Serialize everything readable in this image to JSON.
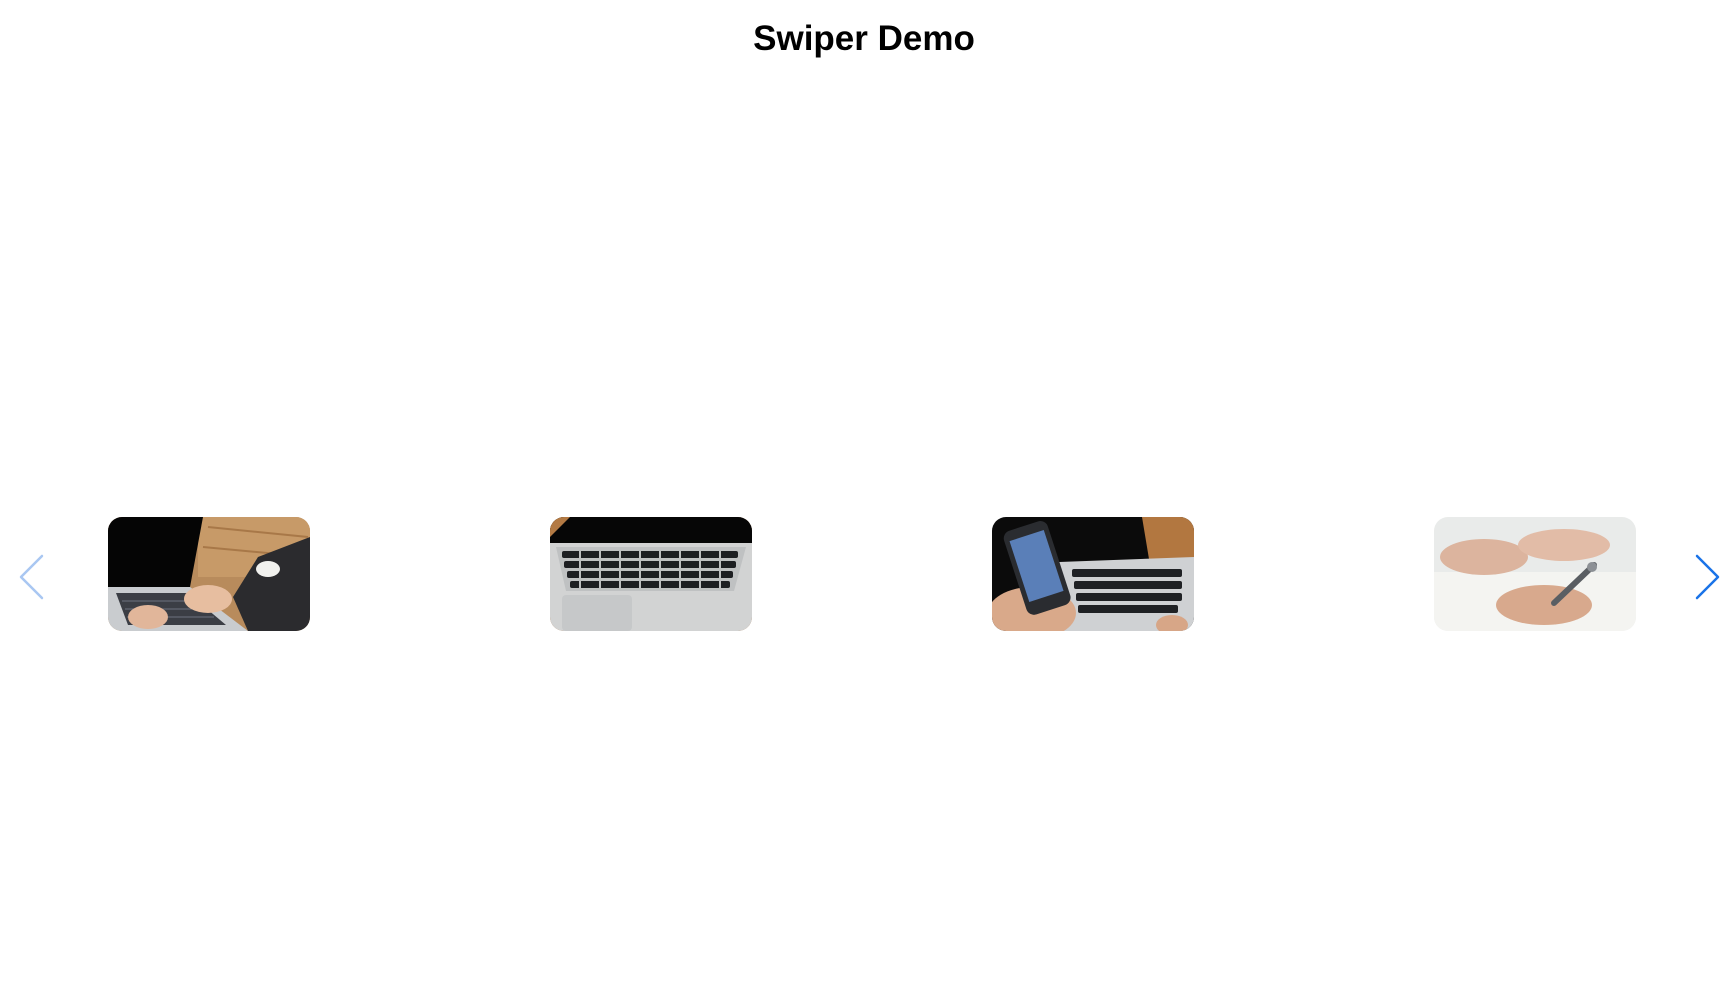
{
  "page": {
    "title": "Swiper Demo"
  },
  "colors": {
    "nav_active": "#1a73e8",
    "nav_disabled": "#a9c7f2"
  },
  "navigation": {
    "prev": {
      "icon": "chevron-left-icon",
      "state": "disabled"
    },
    "next": {
      "icon": "chevron-right-icon",
      "state": "enabled"
    }
  },
  "slides": [
    {
      "image": "hands-typing-on-laptop-photo"
    },
    {
      "image": "laptop-keyboard-photo"
    },
    {
      "image": "hand-holding-smartphone-photo"
    },
    {
      "image": "hand-writing-with-pen-photo"
    }
  ]
}
